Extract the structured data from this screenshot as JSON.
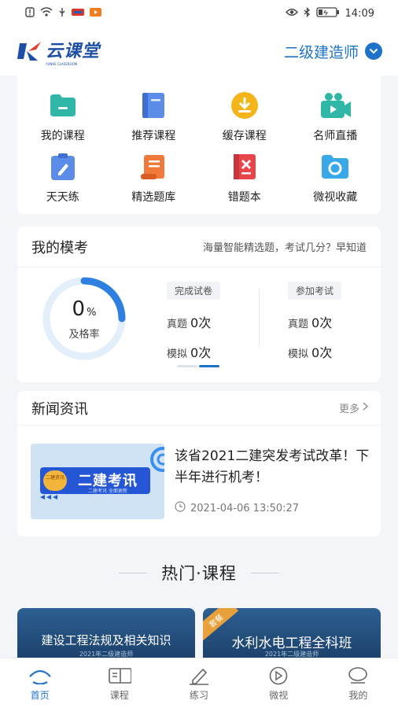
{
  "status": {
    "time": "14:09"
  },
  "header": {
    "logo_text": "云课堂",
    "logo_sub": "YUNKE CLASSROOM",
    "exam_select": "二级建造师"
  },
  "menu": {
    "items": [
      {
        "label": "我的课程",
        "icon": "folder-icon"
      },
      {
        "label": "推荐课程",
        "icon": "book-icon"
      },
      {
        "label": "缓存课程",
        "icon": "download-icon"
      },
      {
        "label": "名师直播",
        "icon": "video-camera-icon"
      },
      {
        "label": "天天练",
        "icon": "clipboard-edit-icon"
      },
      {
        "label": "精选题库",
        "icon": "scroll-icon"
      },
      {
        "label": "错题本",
        "icon": "error-book-icon"
      },
      {
        "label": "微视收藏",
        "icon": "heart-folder-icon"
      }
    ]
  },
  "mock_exam": {
    "title": "我的模考",
    "subtitle": "海量智能精选题，考试几分？早知道",
    "pass_rate": "0",
    "pass_rate_unit": "%",
    "pass_rate_label": "及格率",
    "pass_rate_fraction": 0.0,
    "finished": {
      "tag": "完成试卷",
      "real_label": "真题",
      "real_value": "0次",
      "mock_label": "模拟",
      "mock_value": "0次"
    },
    "joined": {
      "tag": "参加考试",
      "real_label": "真题",
      "real_value": "0次",
      "mock_label": "模拟",
      "mock_value": "0次"
    }
  },
  "news": {
    "title": "新闻资讯",
    "more": "更多",
    "item": {
      "headline": "该省2021二建突发考试改革！下半年进行机考！",
      "date": "2021-04-06 13:50:27",
      "image_title": "二建考讯",
      "image_tag": "二建资讯",
      "image_caption": "二建考讯 全面更新"
    }
  },
  "hot_courses": {
    "title": "热门·课程",
    "items": [
      {
        "name": "建设工程法规及相关知识",
        "sub": "2021年二级建造师",
        "badge": ""
      },
      {
        "name": "水利水电工程全科班",
        "sub": "2021年二级建造师",
        "badge": "套餐"
      }
    ]
  },
  "tabbar": {
    "items": [
      {
        "label": "首页",
        "icon": "home-icon",
        "active": true
      },
      {
        "label": "课程",
        "icon": "open-book-icon",
        "active": false
      },
      {
        "label": "练习",
        "icon": "pen-icon",
        "active": false
      },
      {
        "label": "微视",
        "icon": "play-circle-icon",
        "active": false
      },
      {
        "label": "我的",
        "icon": "profile-icon",
        "active": false
      }
    ]
  },
  "colors": {
    "accent": "#1e73c9",
    "brand": "#1d4fa6"
  }
}
